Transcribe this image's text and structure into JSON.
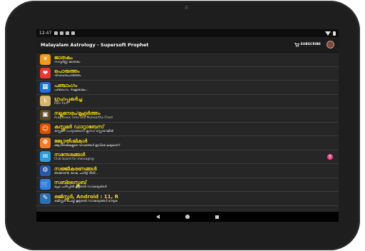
{
  "status": {
    "time": "12:47"
  },
  "appbar": {
    "title": "Malayalam Astrology - Supersoft Prophet",
    "subscribe": "SUBSCRIBE"
  },
  "colors": {
    "title_yellow": "#f0d515",
    "badge_pink": "#e84a8a",
    "background": "#262626"
  },
  "menu": [
    {
      "title": "ജാതകം",
      "subtitle": "സമ്പൂർണ്ണ ജാതകം",
      "icon": "sun-zodiac-icon",
      "glyph": "☀"
    },
    {
      "title": "പൊരുത്തം",
      "subtitle": "വിവാഹപൊരുത്തം",
      "icon": "hearts-icon",
      "glyph": "❤"
    },
    {
      "title": "പഞ്ചാംഗം",
      "subtitle": "പഞ്ചാംഗം, രാഹുകാലം...",
      "icon": "calendar-icon",
      "glyph": "▦"
    },
    {
      "title": "ഗ്രഹപ്പകർച്ച",
      "subtitle": "Rasi Turn",
      "icon": "saturn-icon",
      "glyph": "♄"
    },
    {
      "title": "നല്ലനേരം/മുഹൂർത്തം",
      "subtitle": "Auspicious Time and Muhoortha Chart",
      "icon": "muhoortham-icon",
      "glyph": "▣"
    },
    {
      "title": "കസ്റ്റമർ ഡാറ്റാബേസ്",
      "subtitle": "കസ്റ്റമർ ഡാറ്റാബേസ് ക്ലൗഡ് സ്റ്റോറേജിൽ",
      "icon": "customer-database-icon",
      "glyph": "☺"
    },
    {
      "title": "ജ്യോതിഷികൾ",
      "subtitle": "ജ്യോതിഷികളുടെ വിവരങ്ങൾ ഇവിടെ ലഭ്യമാണ്",
      "icon": "astrologer-icon",
      "glyph": "☸"
    },
    {
      "title": "സന്ദേശങ്ങൾ",
      "subtitle": "Chat board for messaging",
      "icon": "chat-icon",
      "glyph": "✉",
      "badge": "0"
    },
    {
      "title": "സജ്ജീകരണങ്ങൾ",
      "subtitle": "അക്കൗണ്ട്, ഭാഷ, ചാർട്ട് രീതി...",
      "icon": "settings-gear-icon",
      "glyph": "⚙"
    },
    {
      "title": "സബ്സ്ക്രൈബ്",
      "subtitle": "പ്രോ പതിപ്പിൽ കൂടുതൽ സൗകര്യങ്ങൾ",
      "icon": "subscribe-cart-icon",
      "glyph": "🛒"
    },
    {
      "title": "രജിസ്റ്റർ, Android : 11, R",
      "subtitle": "രജിസ്റ്റർ ചെയ്ത് കൂടുതൽ സൗകര്യങ്ങൾ നേടുക",
      "icon": "register-icon",
      "glyph": "✎"
    }
  ]
}
